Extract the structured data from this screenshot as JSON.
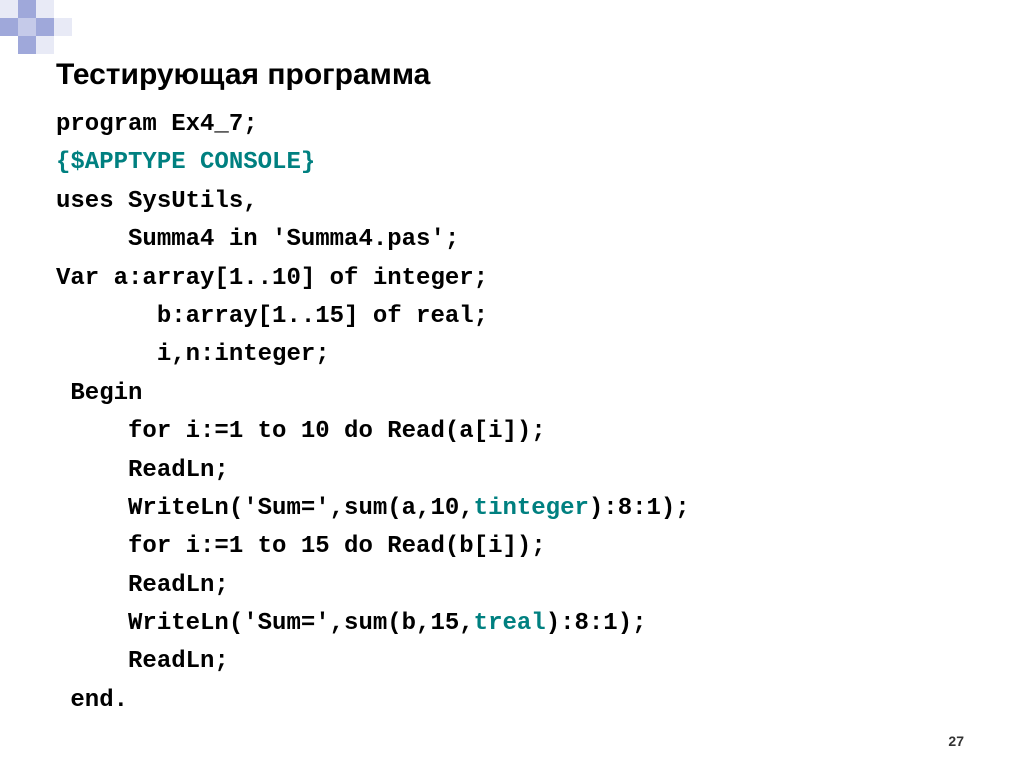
{
  "title": "Тестирующая программа",
  "page_number": "27",
  "code": {
    "l1": "program Ex4_7;",
    "l2": "{$APPTYPE CONSOLE}",
    "l3": "uses SysUtils,",
    "l4": "     Summa4 in 'Summa4.pas';",
    "l5": "Var a:array[1..10] of integer;",
    "l6": "       b:array[1..15] of real;",
    "l7": "       i,n:integer;",
    "l8": " Begin",
    "l9": "     for i:=1 to 10 do Read(a[i]);",
    "l10": "     ReadLn;",
    "l11a": "     WriteLn('Sum=',sum(a,10,",
    "l11b": "tinteger",
    "l11c": "):8:1);",
    "l12": "     for i:=1 to 15 do Read(b[i]);",
    "l13": "     ReadLn;",
    "l14a": "     WriteLn('Sum=',sum(b,15,",
    "l14b": "treal",
    "l14c": "):8:1);",
    "l15": "     ReadLn;",
    "l16": " end."
  }
}
